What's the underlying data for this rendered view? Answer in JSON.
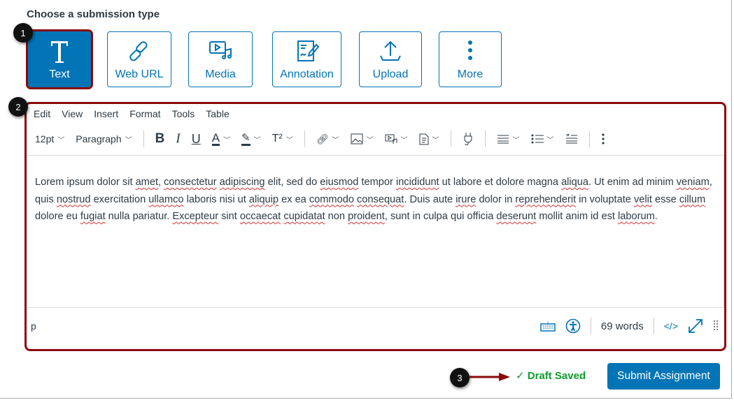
{
  "heading": "Choose a submission type",
  "submission_types": [
    {
      "label": "Text",
      "icon": "text-t-icon",
      "active": true
    },
    {
      "label": "Web URL",
      "icon": "link-icon"
    },
    {
      "label": "Media",
      "icon": "media-icon"
    },
    {
      "label": "Annotation",
      "icon": "annotation-icon"
    },
    {
      "label": "Upload",
      "icon": "upload-icon"
    },
    {
      "label": "More",
      "icon": "more-vertical-icon"
    }
  ],
  "badges": [
    "1",
    "2",
    "3"
  ],
  "menu": [
    "Edit",
    "View",
    "Insert",
    "Format",
    "Tools",
    "Table"
  ],
  "toolbar": {
    "font_size": "12pt",
    "block": "Paragraph",
    "bold": "B",
    "italic": "I",
    "underline": "U",
    "font_color": "A",
    "superscript": "T²"
  },
  "content": [
    {
      "t": "Lorem ipsum dolor sit "
    },
    {
      "t": "amet",
      "sp": 1
    },
    {
      "t": ", "
    },
    {
      "t": "consectetur",
      "sp": 1
    },
    {
      "t": " "
    },
    {
      "t": "adipiscing",
      "sp": 1
    },
    {
      "t": " elit, sed do "
    },
    {
      "t": "eiusmod",
      "sp": 1
    },
    {
      "t": " tempor "
    },
    {
      "t": "incididunt",
      "sp": 1
    },
    {
      "t": " ut labore et dolore magna "
    },
    {
      "t": "aliqua",
      "sp": 1
    },
    {
      "t": ". Ut enim ad minim "
    },
    {
      "t": "veniam",
      "sp": 1
    },
    {
      "t": ", quis "
    },
    {
      "t": "nostrud",
      "sp": 1
    },
    {
      "t": " exercitation "
    },
    {
      "t": "ullamco",
      "sp": 1
    },
    {
      "t": " laboris nisi ut "
    },
    {
      "t": "aliquip",
      "sp": 1
    },
    {
      "t": " ex ea "
    },
    {
      "t": "commodo",
      "sp": 1
    },
    {
      "t": " "
    },
    {
      "t": "consequat",
      "sp": 1
    },
    {
      "t": ". Duis aute "
    },
    {
      "t": "irure",
      "sp": 1
    },
    {
      "t": " dolor in "
    },
    {
      "t": "reprehenderit",
      "sp": 1
    },
    {
      "t": " in voluptate "
    },
    {
      "t": "velit",
      "sp": 1
    },
    {
      "t": " esse "
    },
    {
      "t": "cillum",
      "sp": 1
    },
    {
      "t": " dolore eu "
    },
    {
      "t": "fugiat",
      "sp": 1
    },
    {
      "t": " nulla pariatur. "
    },
    {
      "t": "Excepteur",
      "sp": 1
    },
    {
      "t": " sint "
    },
    {
      "t": "occaecat",
      "sp": 1
    },
    {
      "t": " "
    },
    {
      "t": "cupidatat",
      "sp": 1
    },
    {
      "t": " non "
    },
    {
      "t": "proident",
      "sp": 1
    },
    {
      "t": ", sunt in culpa qui officia "
    },
    {
      "t": "deserunt",
      "sp": 1
    },
    {
      "t": " mollit anim id est "
    },
    {
      "t": "laborum",
      "sp": 1
    },
    {
      "t": "."
    }
  ],
  "statusbar": {
    "path": "p",
    "word_count": "69 words",
    "html_toggle": "</>"
  },
  "footer": {
    "draft_status": "Draft Saved",
    "submit_label": "Submit Assignment"
  },
  "colors": {
    "brand": "#0374b5",
    "callout": "#8b0a0a",
    "success": "#0b9e2a"
  }
}
